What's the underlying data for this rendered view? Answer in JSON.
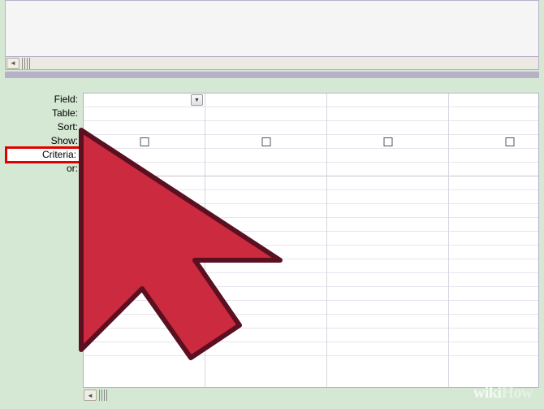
{
  "labels": {
    "field": "Field:",
    "table": "Table:",
    "sort": "Sort:",
    "show": "Show:",
    "criteria": "Criteria:",
    "or": "or:"
  },
  "highlight": "criteria",
  "columns": 4,
  "watermark": {
    "brand": "wiki",
    "suffix": "How"
  },
  "colors": {
    "highlight_border": "#e00000",
    "arrow_fill": "#cc2a3f",
    "arrow_stroke": "#5a1020"
  }
}
